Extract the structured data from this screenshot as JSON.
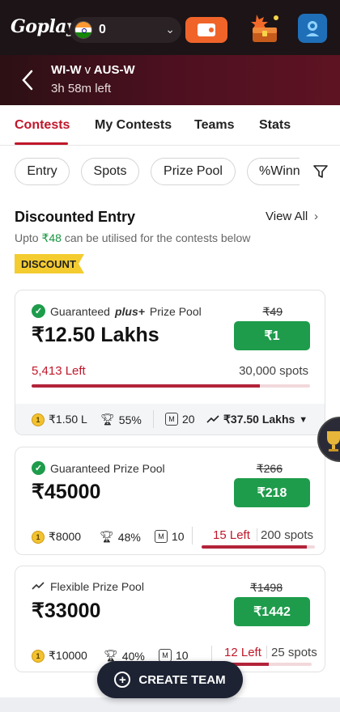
{
  "topbar": {
    "logo": "Goplay",
    "wallet_amount": "0",
    "icons": {
      "wallet": "wallet-icon",
      "rewards": "rewards-chest-icon",
      "profile": "profile-avatar-icon"
    }
  },
  "match": {
    "team1": "WI-W",
    "vs": "v",
    "team2": "AUS-W",
    "time_left": "3h 58m left"
  },
  "tabs": [
    "Contests",
    "My Contests",
    "Teams",
    "Stats"
  ],
  "filters": [
    "Entry",
    "Spots",
    "Prize Pool",
    "%Winn"
  ],
  "section": {
    "title": "Discounted Entry",
    "view_all": "View All",
    "subtitle_pre": "Upto",
    "subtitle_amount": "₹48",
    "subtitle_post": "can be utilised for the contests below",
    "badge": "DISCOUNT"
  },
  "contests": [
    {
      "pool_prefix": "Guaranteed",
      "pool_plus": "plus+",
      "pool_suffix": "Prize Pool",
      "prize": "₹12.50 Lakhs",
      "old_fee": "₹49",
      "fee": "₹1",
      "left": "5,413 Left",
      "spots": "30,000 spots",
      "filled_fraction": 0.82,
      "first_prize": "₹1.50 L",
      "win_percent": "55%",
      "max_entries": "20",
      "total_prize": "₹37.50 Lakhs"
    },
    {
      "pool_label": "Guaranteed Prize Pool",
      "prize": "₹45000",
      "old_fee": "₹266",
      "fee": "₹218",
      "first_prize": "₹8000",
      "win_percent": "48%",
      "max_entries": "10",
      "left": "15 Left",
      "spots": "200 spots",
      "filled_fraction": 0.93
    },
    {
      "pool_label": "Flexible Prize Pool",
      "prize": "₹33000",
      "old_fee": "₹1498",
      "fee": "₹1442",
      "first_prize": "₹10000",
      "win_percent": "40%",
      "max_entries": "10",
      "left": "12 Left",
      "spots": "25 spots",
      "filled_fraction": 0.52
    }
  ],
  "create_team": "CREATE TEAM",
  "colors": {
    "accent": "#c1172a",
    "green": "#1e9c4b",
    "dark": "#1c1416"
  }
}
